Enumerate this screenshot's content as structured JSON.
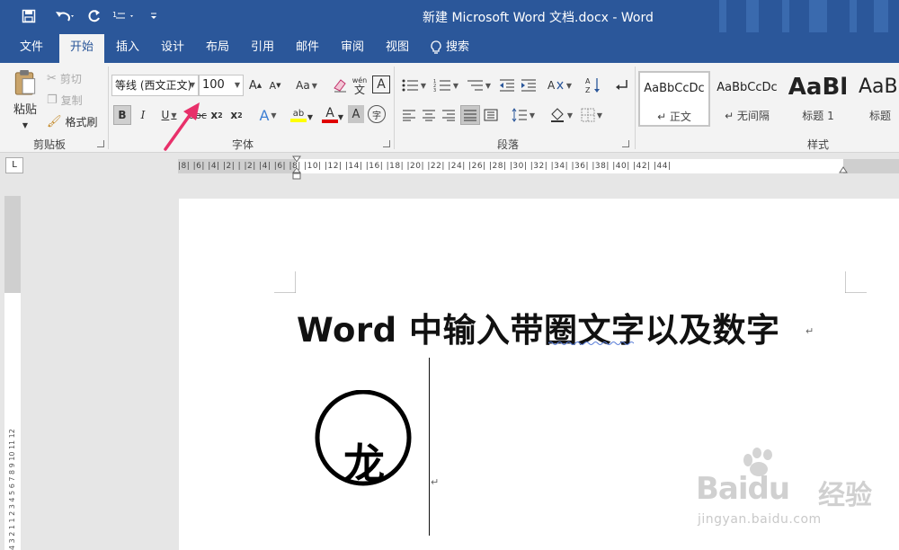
{
  "window": {
    "title": "新建 Microsoft Word 文档.docx - Word"
  },
  "quick_access": [
    {
      "name": "save-icon"
    },
    {
      "name": "undo-icon"
    },
    {
      "name": "redo-icon"
    },
    {
      "name": "touch-mode-icon"
    },
    {
      "name": "customize-qat-icon"
    }
  ],
  "tabs": [
    {
      "label": "文件",
      "active": false
    },
    {
      "label": "开始",
      "active": true
    },
    {
      "label": "插入",
      "active": false
    },
    {
      "label": "设计",
      "active": false
    },
    {
      "label": "布局",
      "active": false
    },
    {
      "label": "引用",
      "active": false
    },
    {
      "label": "邮件",
      "active": false
    },
    {
      "label": "审阅",
      "active": false
    },
    {
      "label": "视图",
      "active": false
    }
  ],
  "tell_me": {
    "label": "搜索",
    "icon": "lightbulb-icon"
  },
  "clipboard": {
    "group_label": "剪贴板",
    "paste_label": "粘贴",
    "cut_label": "剪切",
    "copy_label": "复制",
    "format_painter_label": "格式刷"
  },
  "font": {
    "group_label": "字体",
    "font_name": "等线 (西文正文)",
    "font_size": "100",
    "change_case": "Aa",
    "bold": "B",
    "italic": "I",
    "underline": "U",
    "strike": "abc",
    "subscript": "x",
    "superscript": "x",
    "phonetic_top": "wén",
    "phonetic_bottom": "文",
    "char_border": "A",
    "highlight_label": "ab",
    "font_color_label": "A",
    "shading_label": "A",
    "enclose_label": "字",
    "grow_label": "A",
    "shrink_label": "A",
    "effects_label": "A"
  },
  "paragraph": {
    "group_label": "段落"
  },
  "styles": {
    "group_label": "样式",
    "items": [
      {
        "sample": "AaBbCcDc",
        "name": "↵ 正文",
        "selected": true
      },
      {
        "sample": "AaBbCcDc",
        "name": "↵ 无间隔",
        "selected": false
      },
      {
        "sample": "AaBl",
        "name": "标题 1",
        "selected": false
      },
      {
        "sample": "AaBl",
        "name": "标题",
        "selected": false
      }
    ]
  },
  "ruler": {
    "corner": "L",
    "horizontal_text": "|8|  |6|  |4|  |2|    |  |2|  |4|  |6|  |8|  |10|  |12|  |14|  |16|  |18|  |20|  |22|  |24|  |26|  |28|  |30|  |32|  |34|  |36|  |38|  |40|  |42|  |44|",
    "vertical_text": "4  3  2  1     1  2  3  4  5  6  7  8  9  10  11  12"
  },
  "document": {
    "heading": "Word 中输入带圈文字以及数字",
    "enclosed_char": "龙",
    "para_mark": "↵"
  },
  "watermark": {
    "brand": "Baidu",
    "cn": "经验",
    "url": "jingyan.baidu.com"
  },
  "colors": {
    "accent": "#2b579a",
    "ribbon_bg": "#f3f3f3",
    "highlight_yellow": "#ffff00",
    "font_red": "#e00000",
    "annotation_pink": "#e8306a"
  }
}
